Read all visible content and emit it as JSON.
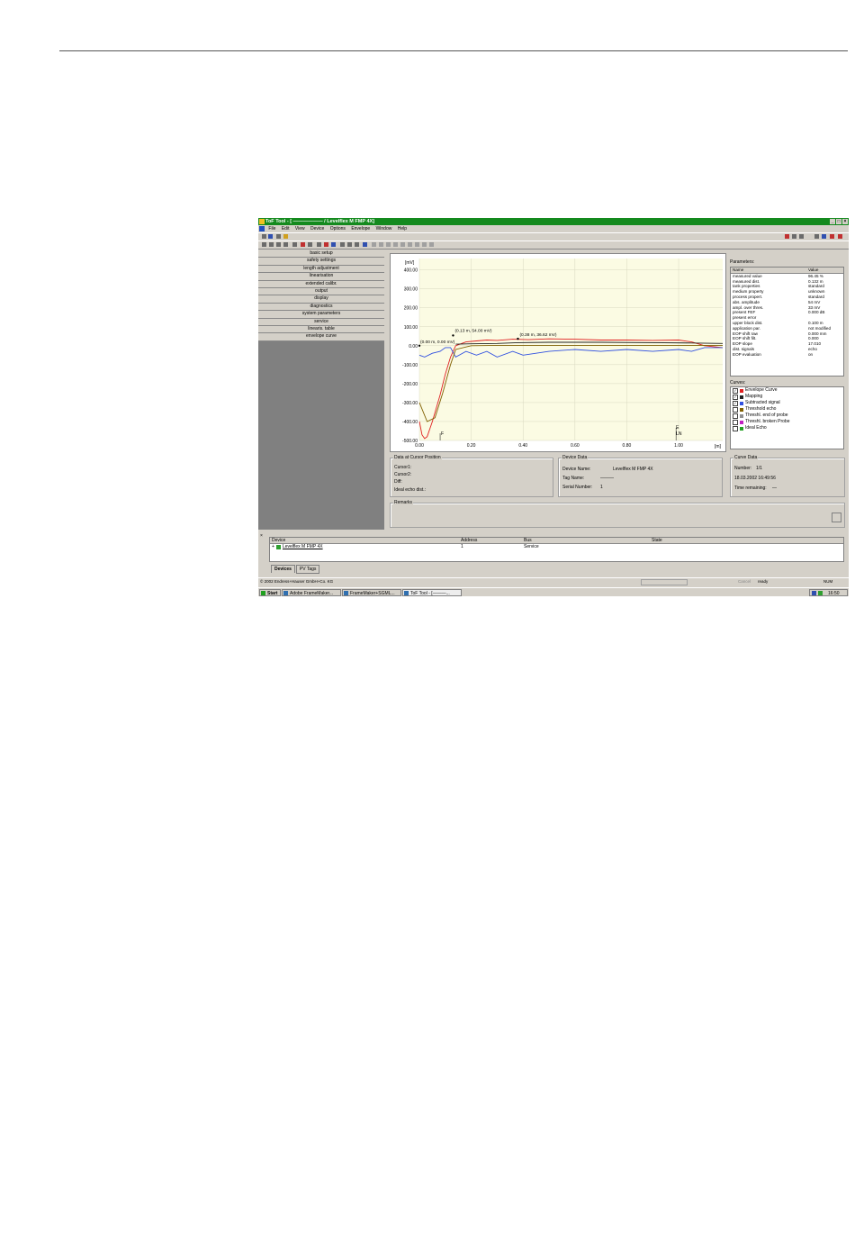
{
  "window": {
    "title": "ToF Tool - [ —————— / Levelflex M FMP 4X]",
    "controls": [
      "_",
      "□",
      "×"
    ]
  },
  "menu": [
    "File",
    "Edit",
    "View",
    "Device",
    "Options",
    "Envelope",
    "Window",
    "Help"
  ],
  "nav_items": [
    "basic setup",
    "safety settings",
    "length adjustment",
    "linearisation",
    "extended calibr.",
    "output",
    "display",
    "diagnostics",
    "system parameters",
    "service",
    "linearis. table",
    "envelope curve"
  ],
  "chart_data": {
    "type": "line",
    "ylabel": "[mV]",
    "xlabel": "[m]",
    "x_ticks": [
      "0.00",
      "0.20",
      "0.40",
      "0.60",
      "0.80",
      "1.00"
    ],
    "y_ticks": [
      "400.00",
      "300.00",
      "200.00",
      "100.00",
      "0.00",
      "-100.00",
      "-200.00",
      "-300.00",
      "-400.00",
      "-500.00"
    ],
    "xlim": [
      0,
      1.17
    ],
    "ylim": [
      -500,
      460
    ],
    "series": [
      {
        "name": "Envelope Curve",
        "color": "#e02020",
        "x": [
          0,
          0.01,
          0.02,
          0.03,
          0.05,
          0.08,
          0.1,
          0.12,
          0.14,
          0.18,
          0.22,
          0.26,
          0.3,
          0.36,
          0.42,
          0.5,
          0.6,
          0.7,
          0.8,
          0.9,
          1.0,
          1.05,
          1.1,
          1.17
        ],
        "y": [
          -400,
          -470,
          -490,
          -480,
          -400,
          -260,
          -150,
          -60,
          0,
          20,
          25,
          30,
          28,
          34,
          32,
          36,
          34,
          30,
          30,
          28,
          30,
          20,
          0,
          -10
        ]
      },
      {
        "name": "Mapping",
        "color": "#202020",
        "x": [
          0.14,
          0.2,
          0.3,
          0.38,
          0.5,
          0.7,
          0.9,
          1.05,
          1.17
        ],
        "y": [
          8,
          10,
          12,
          16,
          18,
          18,
          16,
          14,
          12
        ]
      },
      {
        "name": "Subtracted signal",
        "color": "#3050e0",
        "x": [
          0,
          0.02,
          0.05,
          0.08,
          0.1,
          0.12,
          0.14,
          0.18,
          0.22,
          0.26,
          0.3,
          0.36,
          0.4,
          0.45,
          0.5,
          0.6,
          0.7,
          0.8,
          0.9,
          1.0,
          1.05,
          1.1,
          1.17
        ],
        "y": [
          -50,
          -60,
          -40,
          -30,
          -10,
          -10,
          -60,
          -30,
          -50,
          -30,
          -60,
          -30,
          -50,
          -40,
          -30,
          -20,
          -30,
          -20,
          -30,
          -20,
          -30,
          -10,
          -10
        ]
      },
      {
        "name": "Threshold echo",
        "color": "#806000",
        "x": [
          0.0,
          0.03,
          0.06,
          0.09,
          0.12,
          0.14,
          0.2,
          0.3,
          0.4,
          0.5,
          0.6,
          0.7,
          0.8,
          0.9,
          1.0,
          1.1,
          1.17
        ],
        "y": [
          -300,
          -400,
          -380,
          -250,
          -100,
          -20,
          0,
          2,
          2,
          2,
          2,
          2,
          2,
          2,
          2,
          2,
          2
        ]
      }
    ],
    "annotations": [
      "(0.00 m, 0.00 mV)",
      "(0.13 m, 54.00 mV)",
      "(0.38 m, 36.62 mV)"
    ],
    "markers": [
      "F",
      "E",
      "LN"
    ]
  },
  "parameters": {
    "label": "Parameters:",
    "header": [
      "Name",
      "Value"
    ],
    "rows": [
      [
        "measured value",
        "96.45 %"
      ],
      [
        "measured dist.",
        "0.132 m"
      ],
      [
        "tank properties",
        "standard"
      ],
      [
        "medium property",
        "unknown"
      ],
      [
        "process propert.",
        "standard"
      ],
      [
        "abs. amplitude",
        "54 mV"
      ],
      [
        "ampl. over thres.",
        "33 mV"
      ],
      [
        "present FEF",
        "0.000 dB"
      ],
      [
        "present error",
        ""
      ],
      [
        "upper block dist.",
        "0.100 m"
      ],
      [
        "application par.",
        "not modified"
      ],
      [
        "EOP shift raw",
        "0.000 mm"
      ],
      [
        "EOP shift filt.",
        "0.000"
      ],
      [
        "EOP slope",
        "17.010"
      ],
      [
        "dist. signals",
        "echo"
      ],
      [
        "EOP evaluation",
        "on"
      ]
    ]
  },
  "curves": {
    "label": "Curves:",
    "items": [
      {
        "name": "Envelope Curve",
        "checked": true,
        "color": "#e02020"
      },
      {
        "name": "Mapping",
        "checked": true,
        "color": "#202020"
      },
      {
        "name": "Subtracted signal",
        "checked": true,
        "color": "#3050e0"
      },
      {
        "name": "Threshold echo",
        "checked": false,
        "color": "#806000"
      },
      {
        "name": "Threshl. end of probe",
        "checked": false,
        "color": "#909090"
      },
      {
        "name": "Threshl. broken Probe",
        "checked": false,
        "color": "#c020c0"
      },
      {
        "name": "Ideal Echo",
        "checked": false,
        "color": "#20a020"
      }
    ]
  },
  "cursor_box": {
    "label": "Data at Cursor Position",
    "lines": [
      "Cursor1:",
      "Cursor2:",
      "Diff:",
      "Ideal echo dist.:"
    ]
  },
  "device_box": {
    "label": "Device Data",
    "device_name_label": "Device Name:",
    "device_name": "Levelflex M FMP 4X",
    "tag_label": "Tag Name:",
    "tag": "———",
    "serial_label": "Serial Number:",
    "serial": "1"
  },
  "curve_box": {
    "label": "Curve Data",
    "number_label": "Number:",
    "number": "1/1",
    "timestamp": "18.03.2002 16:49:56",
    "time_label": "Time remaining:",
    "time": "—"
  },
  "remarks_label": "Remarks",
  "device_table": {
    "headers": [
      "Device",
      "Address",
      "Bus",
      "State"
    ],
    "rows": [
      [
        "Levelflex M FMP 4X",
        "1",
        "Service",
        ""
      ]
    ]
  },
  "bottom_tabs": [
    "Devices",
    "PV Tags"
  ],
  "status": {
    "copyright": "© 2002 Endress+Hauser GmbH+Co. KG",
    "cancel": "Cancel",
    "ready": "ready",
    "num": "NUM"
  },
  "taskbar": {
    "start": "Start",
    "tasks": [
      "Adobe FrameMaker...",
      "FrameMaker+SGML...",
      "ToF Tool - [———..."
    ],
    "clock": "16:50"
  }
}
